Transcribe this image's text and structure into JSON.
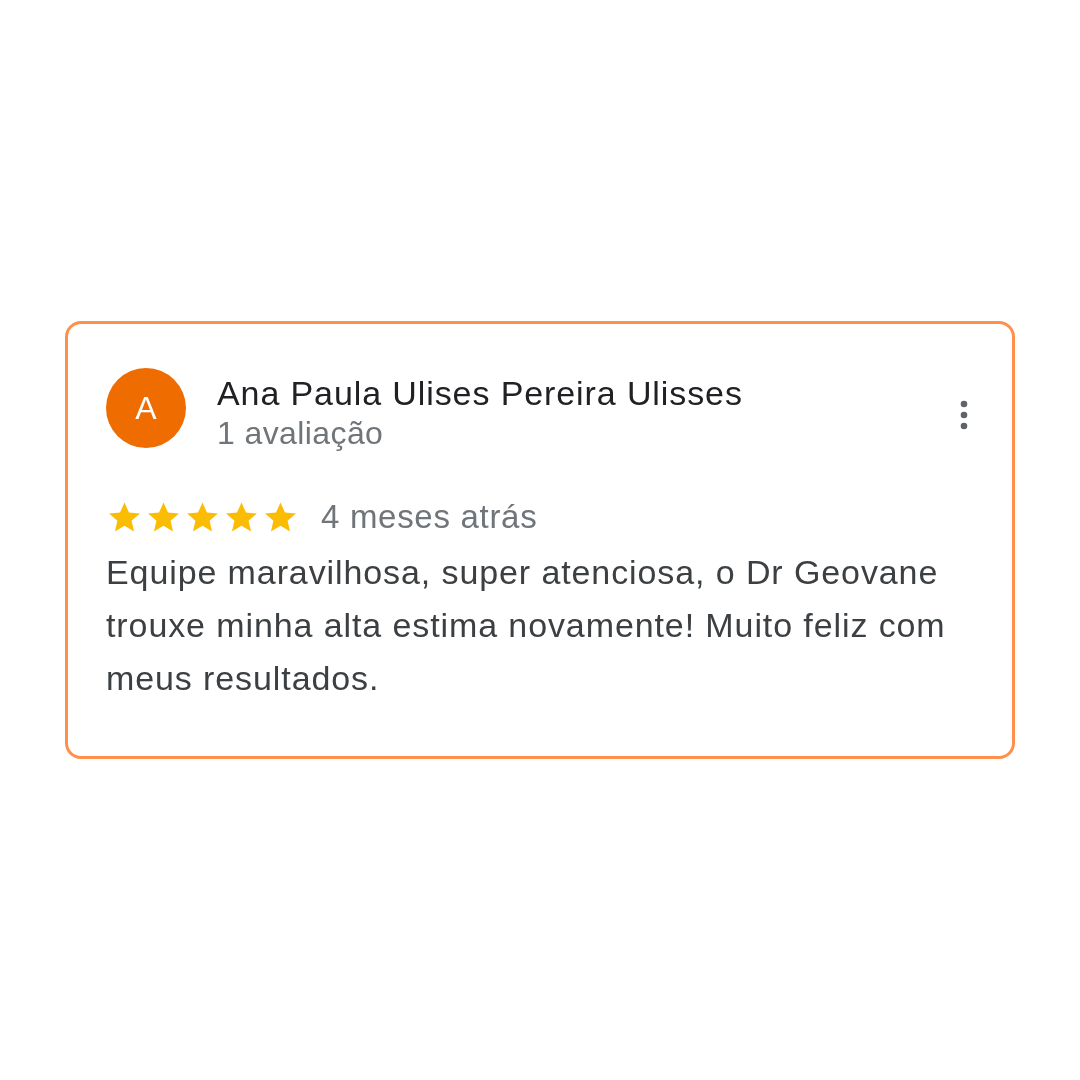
{
  "review": {
    "avatar_letter": "A",
    "author": "Ana Paula Ulises Pereira Ulisses",
    "review_count": "1 avaliação",
    "stars": 5,
    "time": "4 meses atrás",
    "text": "Equipe maravilhosa, super atenciosa, o Dr Geovane trouxe minha alta estima novamente! Muito feliz com meus resultados."
  }
}
